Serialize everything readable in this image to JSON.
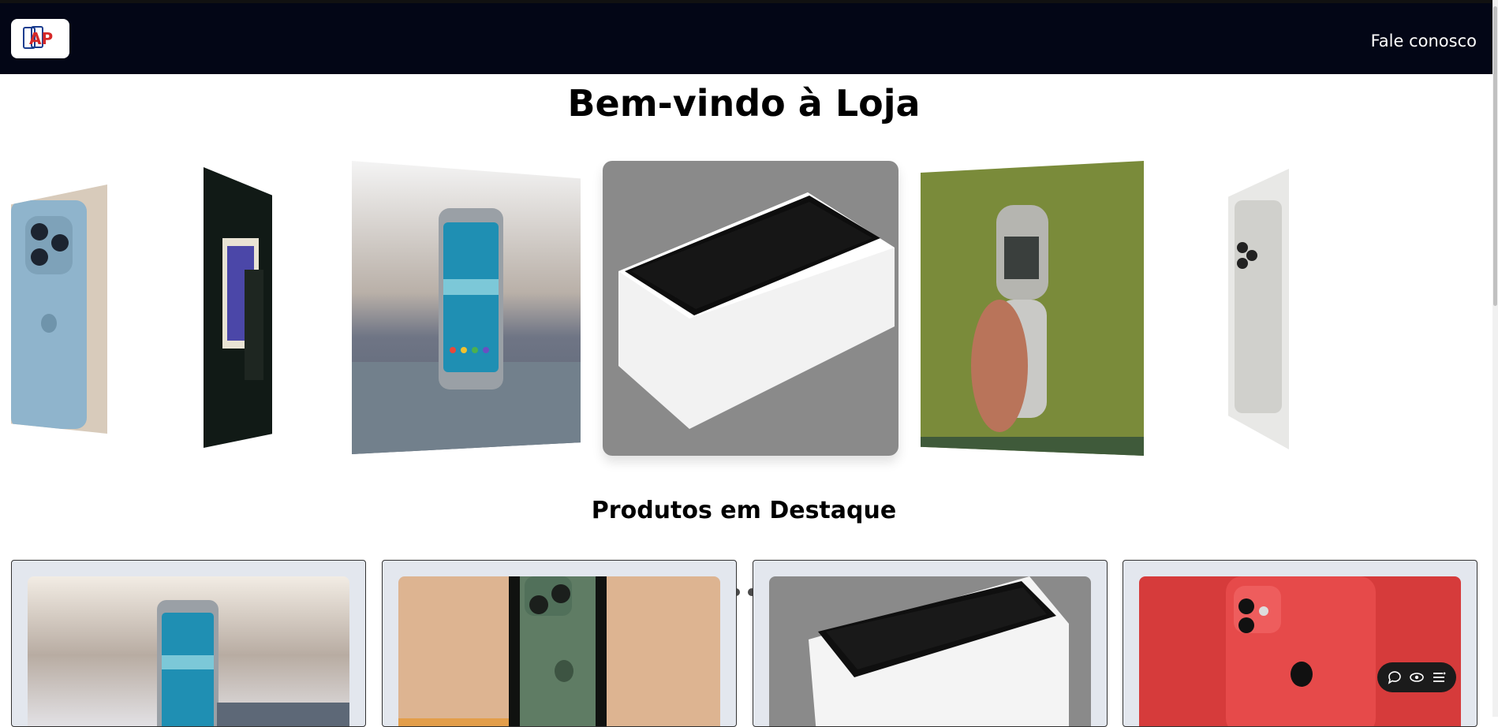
{
  "navbar": {
    "logo_text": "AP",
    "contact_link": "Fale conosco"
  },
  "main": {
    "title": "Bem-vindo à Loja",
    "featured_title": "Produtos em Destaque"
  },
  "carousel": {
    "slides": [
      {
        "subject": "blue iPhone back"
      },
      {
        "subject": "iPhone in box, dark background"
      },
      {
        "subject": "Samsung Galaxy on wooden table"
      },
      {
        "subject": "iPhone on white box"
      },
      {
        "subject": "flip phone held in hand"
      },
      {
        "subject": "white iPhone back"
      }
    ],
    "dot_count": 8,
    "active_dot": 0
  },
  "products": [
    {
      "subject": "Samsung Galaxy smartphone"
    },
    {
      "subject": "green iPhone 13 Pro"
    },
    {
      "subject": "iPhone on white box"
    },
    {
      "subject": "red iPhone 12"
    }
  ],
  "colors": {
    "navbar_bg": "#030616",
    "card_bg": "#e3e7ee",
    "active_dot": "#0d6efd"
  },
  "icons": {
    "widget": [
      "chat-bubble-icon",
      "eye-icon",
      "menu-icon"
    ]
  }
}
